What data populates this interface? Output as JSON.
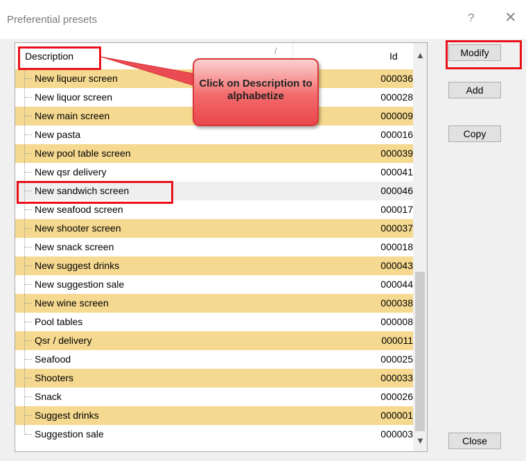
{
  "window": {
    "title": "Preferential presets",
    "help_label": "?",
    "close_label": "✕"
  },
  "list": {
    "header": {
      "description": "Description",
      "sort_indicator": "/",
      "id": "Id"
    },
    "rows": [
      {
        "description": "New liqueur screen",
        "id": "000036"
      },
      {
        "description": "New liquor screen",
        "id": "000028"
      },
      {
        "description": "New main screen",
        "id": "000009"
      },
      {
        "description": "New pasta",
        "id": "000016"
      },
      {
        "description": "New pool table screen",
        "id": "000039"
      },
      {
        "description": "New qsr delivery",
        "id": "000041"
      },
      {
        "description": "New sandwich screen",
        "id": "000046"
      },
      {
        "description": "New seafood screen",
        "id": "000017"
      },
      {
        "description": "New shooter screen",
        "id": "000037"
      },
      {
        "description": "New snack screen",
        "id": "000018"
      },
      {
        "description": "New suggest drinks",
        "id": "000043"
      },
      {
        "description": "New suggestion sale",
        "id": "000044"
      },
      {
        "description": "New wine screen",
        "id": "000038"
      },
      {
        "description": "Pool tables",
        "id": "000008"
      },
      {
        "description": "Qsr / delivery",
        "id": "000011"
      },
      {
        "description": "Seafood",
        "id": "000025"
      },
      {
        "description": "Shooters",
        "id": "000033"
      },
      {
        "description": "Snack",
        "id": "000026"
      },
      {
        "description": "Suggest drinks",
        "id": "000001"
      },
      {
        "description": "Suggestion sale",
        "id": "000003"
      }
    ],
    "scroll_up_icon": "▲",
    "scroll_down_icon": "▼"
  },
  "buttons": {
    "modify": "Modify",
    "add": "Add",
    "copy": "Copy",
    "close": "Close"
  },
  "callout": {
    "text": "Click on Description to alphabetize"
  },
  "colors": {
    "highlight_row": "#f5d990",
    "annotation_red": "#e8101a"
  }
}
